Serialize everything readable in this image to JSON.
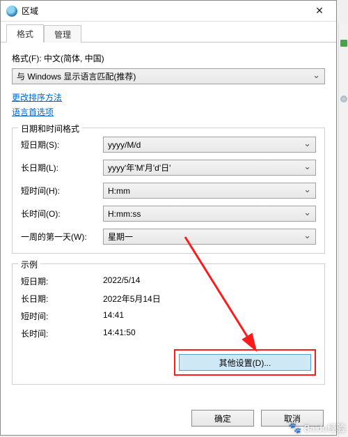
{
  "titlebar": {
    "title": "区域"
  },
  "tabs": {
    "format": "格式",
    "admin": "管理"
  },
  "format_section": {
    "label": "格式(F): 中文(简体, 中国)",
    "dropdown_value": "与 Windows 显示语言匹配(推荐)"
  },
  "links": {
    "sort_method": "更改排序方法",
    "lang_prefs": "语言首选项"
  },
  "datetime_group": {
    "legend": "日期和时间格式",
    "rows": {
      "short_date": {
        "label": "短日期(S):",
        "value": "yyyy/M/d"
      },
      "long_date": {
        "label": "长日期(L):",
        "value": "yyyy'年'M'月'd'日'"
      },
      "short_time": {
        "label": "短时间(H):",
        "value": "H:mm"
      },
      "long_time": {
        "label": "长时间(O):",
        "value": "H:mm:ss"
      },
      "first_day": {
        "label": "一周的第一天(W):",
        "value": "星期一"
      }
    }
  },
  "example_group": {
    "legend": "示例",
    "rows": {
      "short_date": {
        "label": "短日期:",
        "value": "2022/5/14"
      },
      "long_date": {
        "label": "长日期:",
        "value": "2022年5月14日"
      },
      "short_time": {
        "label": "短时间:",
        "value": "14:41"
      },
      "long_time": {
        "label": "长时间:",
        "value": "14:41:50"
      }
    }
  },
  "buttons": {
    "other": "其他设置(D)...",
    "ok": "确定",
    "cancel": "取消"
  },
  "watermark": "Baidu经验"
}
